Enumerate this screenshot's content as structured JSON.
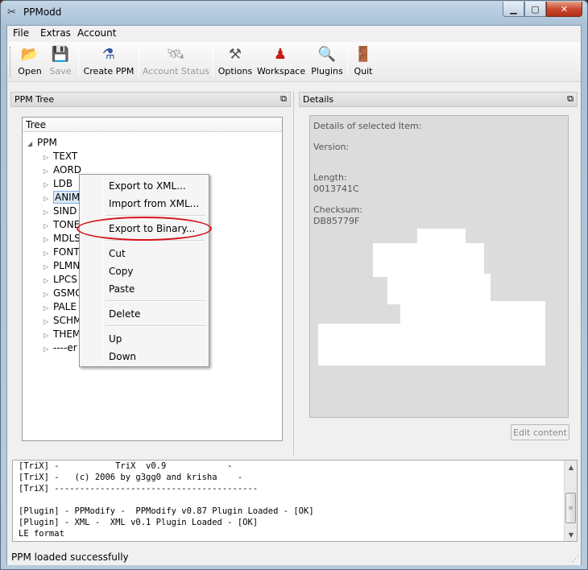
{
  "window": {
    "title": "PPModd",
    "minimize": "▁",
    "maximize": "▢",
    "close": "✕"
  },
  "menubar": {
    "items": [
      "File",
      "Extras",
      "Account"
    ]
  },
  "toolbar": {
    "buttons": [
      {
        "label": "Open",
        "icon": "folder-open-icon",
        "enabled": true
      },
      {
        "label": "Save",
        "icon": "disk-icon",
        "enabled": false
      },
      {
        "label": "Create PPM",
        "icon": "create-icon",
        "enabled": true
      },
      {
        "label": "Account Status",
        "icon": "satellite-icon",
        "enabled": false
      },
      {
        "label": "Options",
        "icon": "tools-icon",
        "enabled": true
      },
      {
        "label": "Workspace",
        "icon": "person-icon",
        "enabled": true
      },
      {
        "label": "Plugins",
        "icon": "magnifier-icon",
        "enabled": true
      },
      {
        "label": "Quit",
        "icon": "exit-icon",
        "enabled": true
      }
    ]
  },
  "tree_panel": {
    "title": "PPM Tree",
    "header": "Tree",
    "root": "PPM",
    "children": [
      "TEXT",
      "AORD",
      "LDB",
      "ANIM",
      "SIND",
      "TONE",
      "MDLS",
      "FONT",
      "PLMN",
      "LPCS",
      "GSMC",
      "PALE",
      "SCHM",
      "THEM",
      "----er"
    ],
    "selected_index": 3
  },
  "details_panel": {
    "title": "Details",
    "heading": "Details of selected Item:",
    "version_label": "Version:",
    "length_label": "Length:",
    "length_value": "0013741C",
    "checksum_label": "Checksum:",
    "checksum_value": "DB85779F",
    "edit_button": "Edit content"
  },
  "context_menu": {
    "items": [
      "Export to XML...",
      "Import from XML...",
      "Export to Binary...",
      "Cut",
      "Copy",
      "Paste",
      "Delete",
      "Up",
      "Down"
    ],
    "highlighted": "Export to Binary..."
  },
  "log": {
    "lines": [
      "[TriX] -           TriX  v0.9            -",
      "[TriX] -   (c) 2006 by g3gg0 and krisha    -",
      "[TriX] ----------------------------------------",
      "",
      "[Plugin] - PPModify -  PPModify v0.87 Plugin Loaded - [OK]",
      "[Plugin] - XML -  XML v0.1 Plugin Loaded - [OK]",
      "LE format"
    ]
  },
  "status": {
    "text": "PPM loaded successfully"
  },
  "colors": {
    "annotation": "#d4141a",
    "selection": "#dbe8f7"
  }
}
